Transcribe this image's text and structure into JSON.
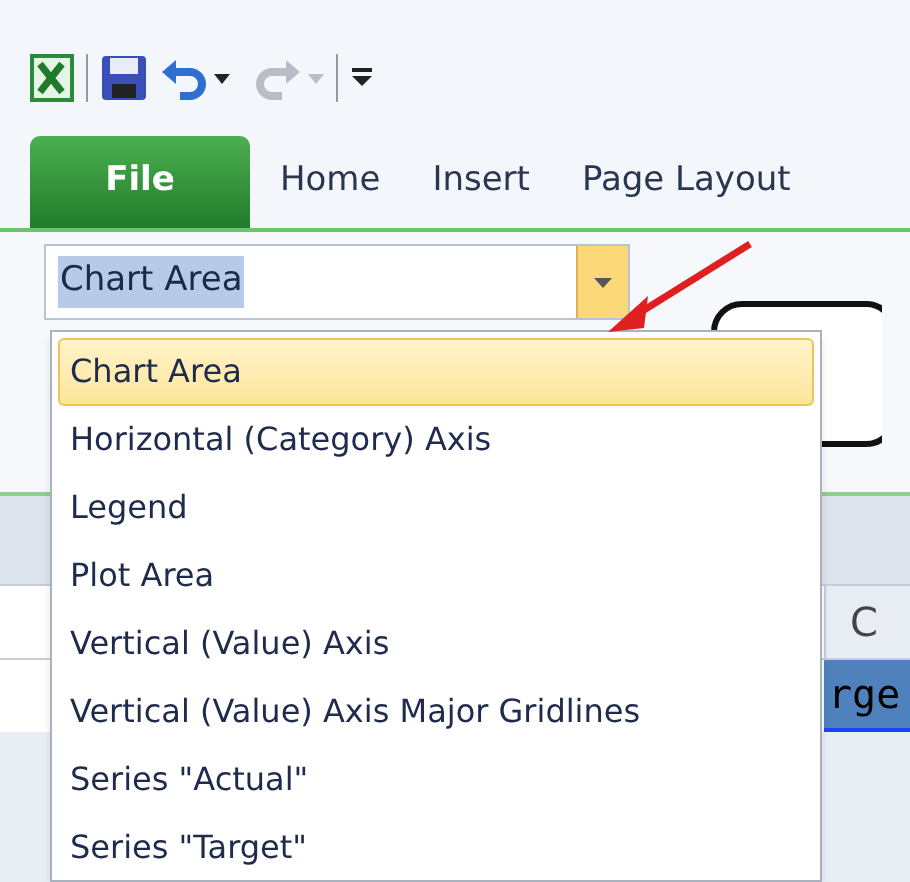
{
  "quick_access_toolbar": [
    {
      "kind": "app"
    },
    {
      "kind": "save"
    },
    {
      "kind": "undo",
      "disabled": false
    },
    {
      "kind": "redo",
      "disabled": true
    },
    {
      "kind": "customize"
    }
  ],
  "tabs": [
    {
      "label": "File",
      "kind": "file",
      "selected": false
    },
    {
      "label": "Home",
      "kind": "tab",
      "selected": false
    },
    {
      "label": "Insert",
      "kind": "tab",
      "selected": false
    },
    {
      "label": "Page Layout",
      "kind": "tab",
      "selected": false
    }
  ],
  "chart_elements": {
    "value": "Chart Area",
    "expanded": true,
    "items": [
      {
        "label": "Chart Area",
        "selected": true
      },
      {
        "label": "Horizontal (Category) Axis",
        "selected": false
      },
      {
        "label": "Legend",
        "selected": false
      },
      {
        "label": "Plot Area",
        "selected": false
      },
      {
        "label": "Vertical (Value) Axis",
        "selected": false
      },
      {
        "label": "Vertical (Value) Axis Major Gridlines",
        "selected": false
      },
      {
        "label": "Series \"Actual\"",
        "selected": false
      },
      {
        "label": "Series \"Target\"",
        "selected": false
      }
    ]
  },
  "sheet": {
    "column_header": "C",
    "cell": {
      "text": "rge",
      "selected": true
    }
  }
}
